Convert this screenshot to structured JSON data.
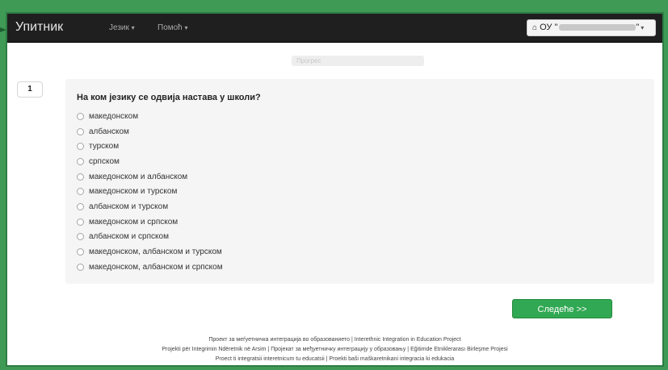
{
  "navbar": {
    "brand": "Упитник",
    "menu": [
      "Језик",
      "Помоћ"
    ],
    "user_label": "ОУ \""
  },
  "progress": {
    "label": "Прогрес",
    "value": 0
  },
  "question": {
    "number": "1",
    "text": "На ком језику се одвија настава у школи?",
    "options": [
      "македонском",
      "албанском",
      "турском",
      "српском",
      "македонском и албанском",
      "македонском и турском",
      "албанском и турском",
      "македонском и српском",
      "албанском и српском",
      "македонском, албанском и турском",
      "македонском, албанском и српском"
    ]
  },
  "next_button": "Следеће >>",
  "footer": {
    "lines": [
      "Проект за меѓуетничка интеграција во образованието | Interethnic Integration in Education Project",
      "Projekti për Integrimin Ndëretnik në Arsim | Пројекат за међуетничку интеграцију у образовању | Eğitimde Etniklerarası Birleşme Projesi",
      "Proect ti integratsii interetnicum tu educatsii | Proekti baši maškaretnikani integracia ki edukacia"
    ]
  },
  "colors": {
    "navbar_bg": "#1f1f1f",
    "frame_bg": "#3f9a55",
    "next_button": "#31a853"
  }
}
